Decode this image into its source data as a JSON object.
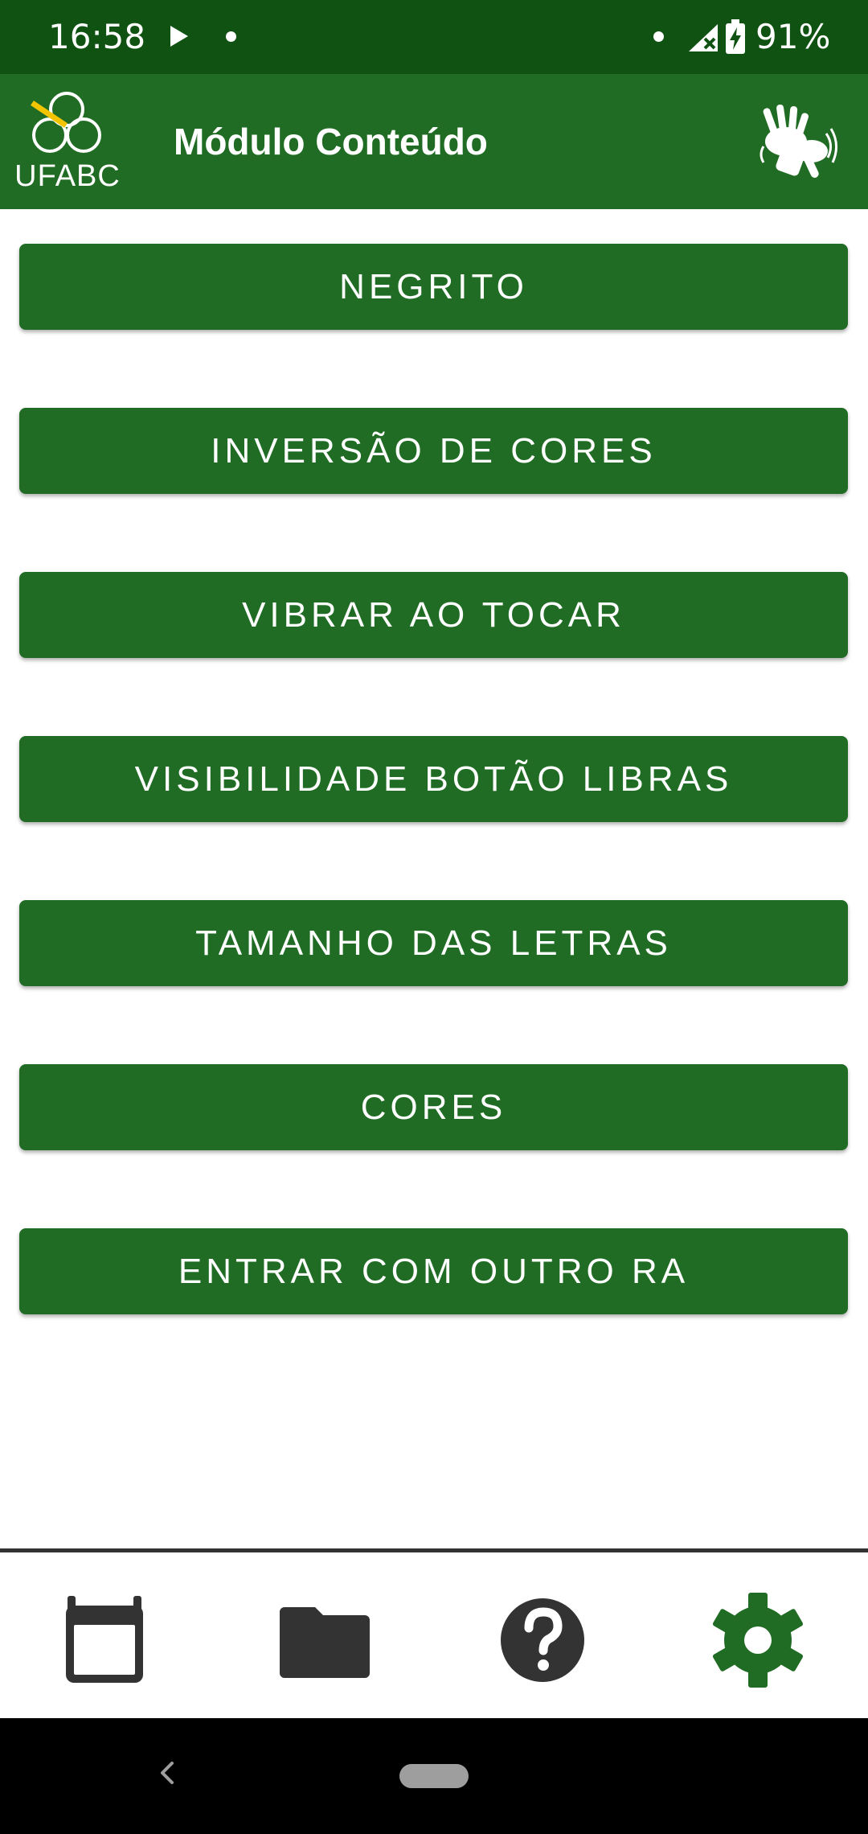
{
  "status_bar": {
    "time": "16:58",
    "battery": "91%",
    "icons": [
      "play-icon",
      "notification-dot-icon",
      "signal-icon",
      "battery-charging-icon"
    ]
  },
  "app_bar": {
    "logo_text": "UFABC",
    "title": "Módulo Conteúdo",
    "libras_icon": "sign-language-hands-icon"
  },
  "menu": {
    "items": [
      {
        "label": "NEGRITO"
      },
      {
        "label": "INVERSÃO DE CORES"
      },
      {
        "label": "VIBRAR AO TOCAR"
      },
      {
        "label": "VISIBILIDADE BOTÃO LIBRAS"
      },
      {
        "label": "TAMANHO DAS LETRAS"
      },
      {
        "label": "CORES"
      },
      {
        "label": "ENTRAR COM OUTRO RA"
      }
    ]
  },
  "bottom_nav": {
    "items": [
      {
        "icon": "calendar-icon",
        "active": false
      },
      {
        "icon": "folder-icon",
        "active": false
      },
      {
        "icon": "help-icon",
        "active": false
      },
      {
        "icon": "settings-icon",
        "active": true
      }
    ]
  },
  "colors": {
    "status_bar": "#0f5212",
    "primary": "#216c25",
    "inactive_icon": "#333333",
    "accent_logo": "#f2c500"
  }
}
